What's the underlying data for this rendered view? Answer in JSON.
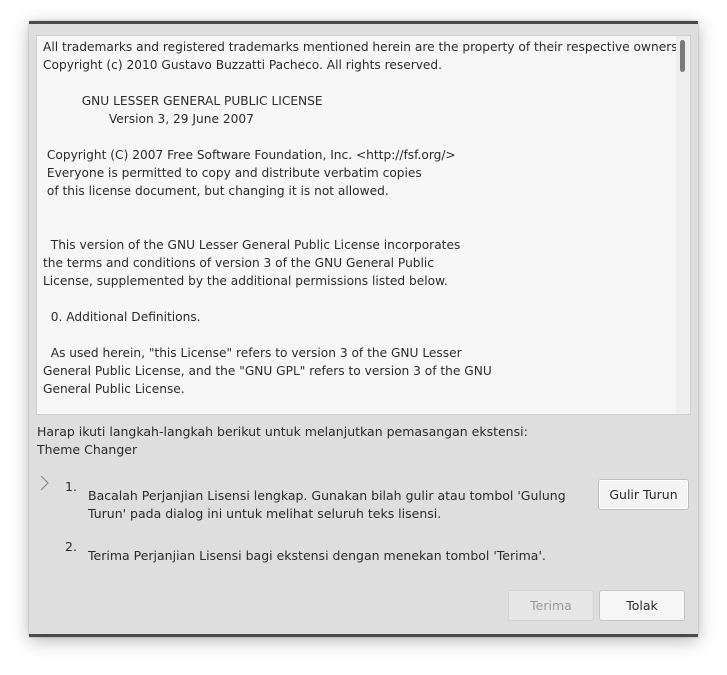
{
  "license": {
    "text": "All trademarks and registered trademarks mentioned herein are the property of their respective owners.\nCopyright (c) 2010 Gustavo Buzzatti Pacheco. All rights reserved.\n\n          GNU LESSER GENERAL PUBLIC LICENSE\n                 Version 3, 29 June 2007\n\n Copyright (C) 2007 Free Software Foundation, Inc. <http://fsf.org/>\n Everyone is permitted to copy and distribute verbatim copies\n of this license document, but changing it is not allowed.\n\n\n  This version of the GNU Lesser General Public License incorporates\nthe terms and conditions of version 3 of the GNU General Public\nLicense, supplemented by the additional permissions listed below.\n\n  0. Additional Definitions.\n\n  As used herein, \"this License\" refers to version 3 of the GNU Lesser\nGeneral Public License, and the \"GNU GPL\" refers to version 3 of the GNU\nGeneral Public License."
  },
  "instruction": {
    "line1": "Harap ikuti langkah-langkah berikut untuk melanjutkan pemasangan ekstensi:",
    "extension_name": "Theme Changer"
  },
  "steps": [
    {
      "number": "1.",
      "text": "Bacalah Perjanjian Lisensi lengkap. Gunakan bilah gulir atau tombol 'Gulung Turun' pada dialog ini untuk melihat seluruh teks lisensi."
    },
    {
      "number": "2.",
      "text": "Terima Perjanjian Lisensi bagi ekstensi dengan menekan tombol 'Terima'."
    }
  ],
  "buttons": {
    "scroll_down": "Gulir Turun",
    "accept": "Terima",
    "decline": "Tolak"
  },
  "icons": {
    "current_step": "chevron-right-icon"
  }
}
